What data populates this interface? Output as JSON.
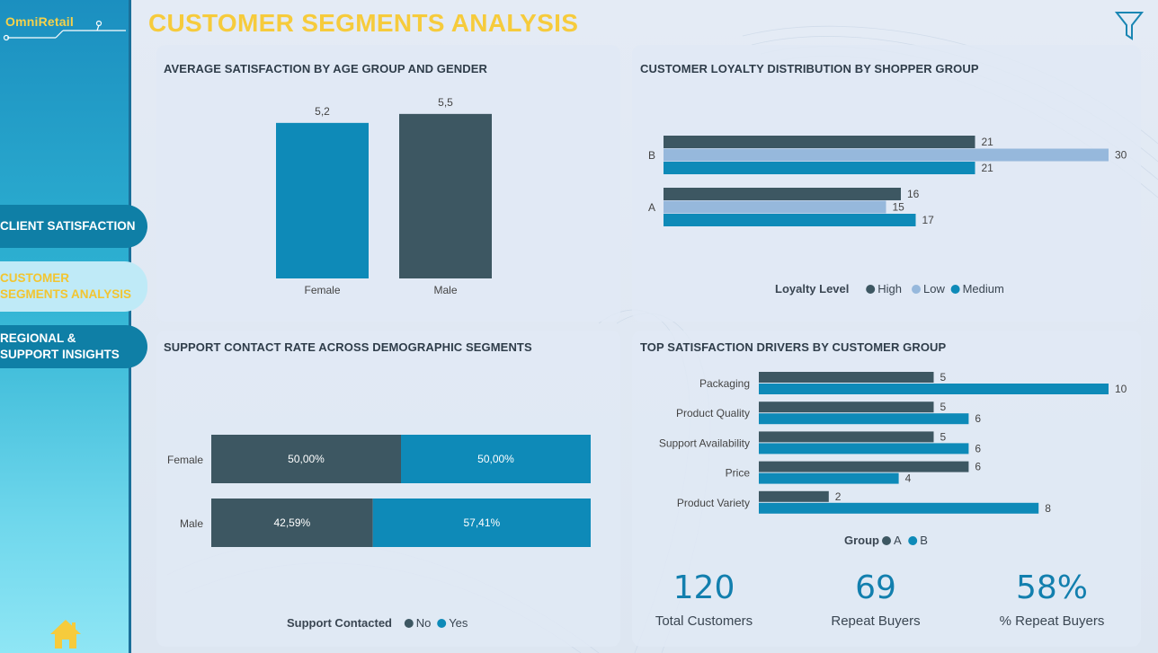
{
  "app": {
    "logo": "OmniRetail",
    "page_title": "CUSTOMER SEGMENTS ANALYSIS"
  },
  "nav": {
    "items": [
      {
        "label_line1": "CLIENT SATISFACTION",
        "label_line2": ""
      },
      {
        "label_line1": "CUSTOMER",
        "label_line2": "SEGMENTS ANALYSIS"
      },
      {
        "label_line1": "REGIONAL &",
        "label_line2": "SUPPORT INSIGHTS"
      }
    ],
    "active": "CUSTOMER SEGMENTS ANALYSIS"
  },
  "icons": {
    "filter": "filter-icon",
    "home": "home-icon"
  },
  "colors": {
    "dark": "#3d5762",
    "blue": "#0e8ab8",
    "light": "#96b8dc",
    "title": "#f6cb3c",
    "kpi": "#127fae"
  },
  "charts": {
    "satisfaction": {
      "title": "AVERAGE SATISFACTION BY AGE GROUP AND GENDER"
    },
    "loyalty": {
      "title": "CUSTOMER LOYALTY DISTRIBUTION BY SHOPPER GROUP",
      "legend_title": "Loyalty Level"
    },
    "support": {
      "title": "SUPPORT CONTACT RATE ACROSS DEMOGRAPHIC SEGMENTS",
      "legend_title": "Support Contacted"
    },
    "drivers": {
      "title": "TOP SATISFACTION DRIVERS BY CUSTOMER GROUP",
      "legend_title": "Group"
    }
  },
  "kpis": [
    {
      "value": "120",
      "label": "Total Customers"
    },
    {
      "value": "69",
      "label": "Repeat Buyers"
    },
    {
      "value": "58%",
      "label": "% Repeat Buyers"
    }
  ],
  "chart_data": [
    {
      "type": "bar",
      "title": "AVERAGE SATISFACTION BY AGE GROUP AND GENDER",
      "categories": [
        "Female",
        "Male"
      ],
      "values": [
        5.2,
        5.5
      ],
      "value_labels": [
        "5,2",
        "5,5"
      ],
      "colors": [
        "#0e8ab8",
        "#3d5762"
      ]
    },
    {
      "type": "bar",
      "orientation": "horizontal",
      "title": "CUSTOMER LOYALTY DISTRIBUTION BY SHOPPER GROUP",
      "categories": [
        "B",
        "A"
      ],
      "series": [
        {
          "name": "High",
          "values": [
            21,
            16
          ],
          "color": "#3d5762"
        },
        {
          "name": "Low",
          "values": [
            30,
            15
          ],
          "color": "#96b8dc"
        },
        {
          "name": "Medium",
          "values": [
            21,
            17
          ],
          "color": "#0e8ab8"
        }
      ],
      "legend_title": "Loyalty Level",
      "legend": "bottom",
      "xlim": [
        0,
        30
      ]
    },
    {
      "type": "bar",
      "orientation": "horizontal",
      "stacked": "100%",
      "title": "SUPPORT CONTACT RATE ACROSS DEMOGRAPHIC SEGMENTS",
      "categories": [
        "Female",
        "Male"
      ],
      "series": [
        {
          "name": "No",
          "values": [
            50.0,
            42.59
          ],
          "labels": [
            "50,00%",
            "42,59%"
          ],
          "color": "#3d5762"
        },
        {
          "name": "Yes",
          "values": [
            50.0,
            57.41
          ],
          "labels": [
            "50,00%",
            "57,41%"
          ],
          "color": "#0e8ab8"
        }
      ],
      "legend_title": "Support Contacted",
      "legend": "bottom"
    },
    {
      "type": "bar",
      "orientation": "horizontal",
      "title": "TOP SATISFACTION DRIVERS BY CUSTOMER GROUP",
      "categories": [
        "Packaging",
        "Product Quality",
        "Support Availability",
        "Price",
        "Product Variety"
      ],
      "series": [
        {
          "name": "A",
          "values": [
            5,
            5,
            5,
            6,
            2
          ],
          "color": "#3d5762"
        },
        {
          "name": "B",
          "values": [
            10,
            6,
            6,
            4,
            8
          ],
          "color": "#0e8ab8"
        }
      ],
      "legend_title": "Group",
      "legend": "bottom",
      "xlim": [
        0,
        10
      ]
    }
  ]
}
